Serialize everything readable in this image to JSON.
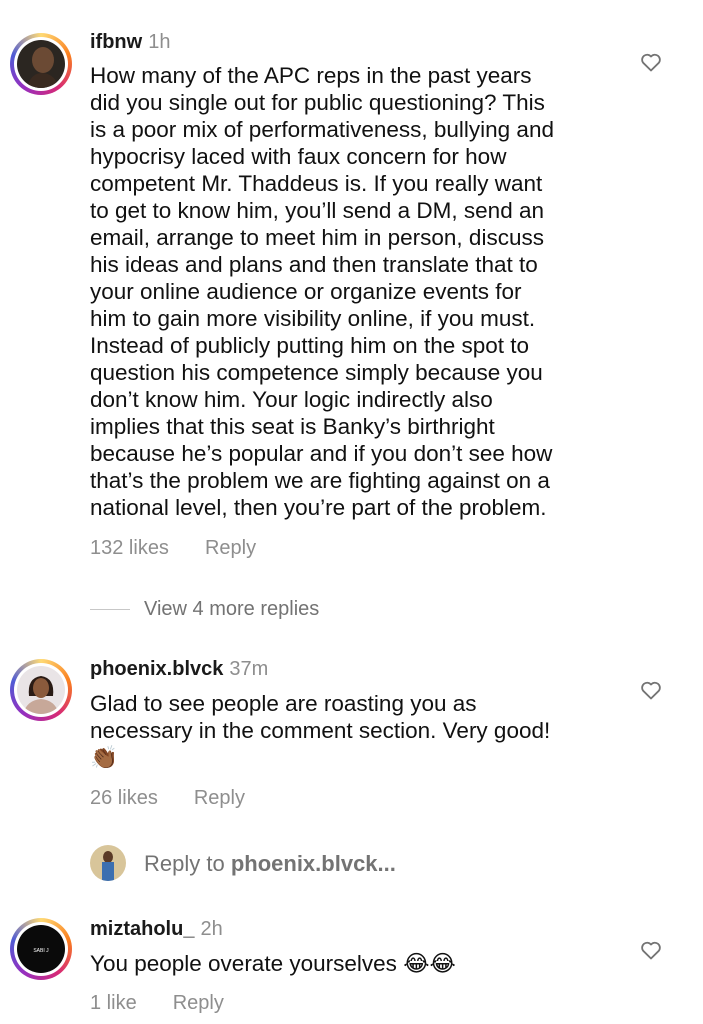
{
  "comments": [
    {
      "username": "ifbnw",
      "time": "1h",
      "text": "How many of the APC reps in the past years\ndid you single out for public questioning? This\nis a poor mix of performativeness, bullying and\nhypocrisy laced with faux concern for how\ncompetent Mr. Thaddeus is. If you really want\nto get to know him, you’ll send a DM, send an\nemail, arrange to meet him in person, discuss\nhis ideas and plans and then translate that to\nyour online audience or organize events for\nhim to gain more visibility online, if you must.\nInstead of publicly putting him on the spot to\nquestion his competence simply because you\ndon’t know him. Your logic indirectly also\nimplies that this seat is Banky’s birthright\nbecause he’s popular and if you don’t see how\nthat’s the problem we are fighting against on a\nnational level, then you’re part of the problem.",
      "likes": "132 likes",
      "reply": "Reply"
    },
    {
      "username": "phoenix.blvck",
      "time": "37m",
      "text": "Glad to see people are roasting you as\nnecessary in the comment section. Very good!\n👏🏾",
      "likes": "26 likes",
      "reply": "Reply"
    },
    {
      "username": "miztaholu_",
      "time": "2h",
      "text": "You people overate yourselves 😂😂",
      "likes": "1 like",
      "reply": "Reply",
      "avatar_text": "SABI J"
    }
  ],
  "view_more": "View 4 more replies",
  "reply_to": {
    "prefix": "Reply to ",
    "username": "phoenix.blvck..."
  },
  "icons": {
    "like": "heart-outline-icon"
  },
  "colors": {
    "secondary_text": "#8e8e8e",
    "ring_gradient": [
      "#feda75",
      "#fa7e1e",
      "#d62976",
      "#962fbf",
      "#4f5bd5"
    ]
  }
}
